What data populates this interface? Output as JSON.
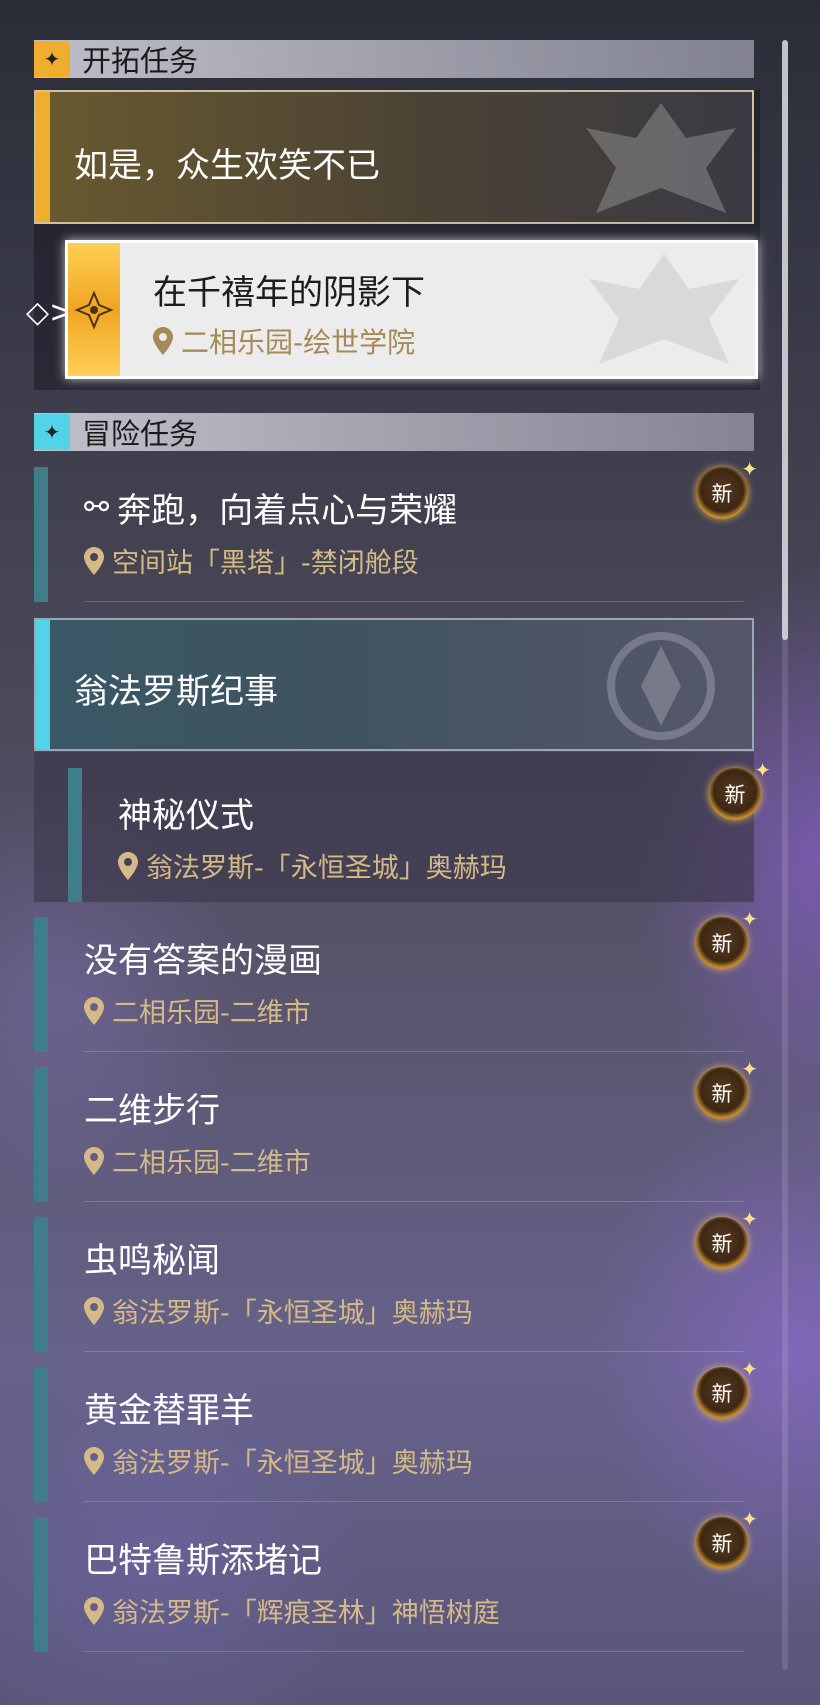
{
  "trailblaze_section": {
    "label": "开拓任务"
  },
  "trailblaze_quest": {
    "title": "如是，众生欢笑不已"
  },
  "current_quest": {
    "title": "在千禧年的阴影下",
    "location": "二相乐园-绘世学院"
  },
  "adventure_section": {
    "label": "冒险任务"
  },
  "event_quest": {
    "title": "翁法罗斯纪事"
  },
  "sub_quest": {
    "title": "神秘仪式",
    "location": "翁法罗斯-「永恒圣城」奥赫玛",
    "badge": "新"
  },
  "quests": [
    {
      "title": "奔跑，向着点心与荣耀",
      "location": "空间站「黑塔」-禁闭舱段",
      "badge": "新"
    },
    {
      "title": "没有答案的漫画",
      "location": "二相乐园-二维市",
      "badge": "新"
    },
    {
      "title": "二维步行",
      "location": "二相乐园-二维市",
      "badge": "新"
    },
    {
      "title": "虫鸣秘闻",
      "location": "翁法罗斯-「永恒圣城」奥赫玛",
      "badge": "新"
    },
    {
      "title": "黄金替罪羊",
      "location": "翁法罗斯-「永恒圣城」奥赫玛",
      "badge": "新"
    },
    {
      "title": "巴特鲁斯添堵记",
      "location": "翁法罗斯-「辉痕圣林」神悟树庭",
      "badge": "新"
    }
  ],
  "colors": {
    "trailblaze_accent": "#f0ae2e",
    "event_accent": "#52d3e8",
    "quest_bar": "#3f7d8a",
    "location_text": "#d5ba88"
  }
}
